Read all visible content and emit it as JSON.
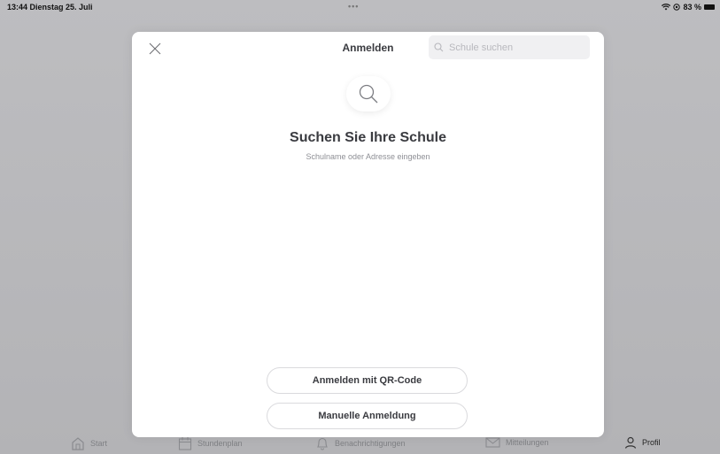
{
  "status_bar": {
    "time_date": "13:44  Dienstag 25. Juli",
    "dots": "•••",
    "battery": "83 %"
  },
  "modal": {
    "title": "Anmelden",
    "search": {
      "placeholder": "Schule suchen",
      "value": ""
    },
    "hero": {
      "title": "Suchen Sie Ihre Schule",
      "subtitle": "Schulname oder Adresse eingeben"
    },
    "buttons": {
      "qr_label": "Anmelden mit QR-Code",
      "manual_label": "Manuelle Anmeldung"
    }
  },
  "tab_bar": {
    "items": [
      {
        "label": "Start",
        "icon": "home-icon"
      },
      {
        "label": "Stundenplan",
        "icon": "calendar-icon"
      },
      {
        "label": "Benachrichtigungen",
        "icon": "bell-icon"
      },
      {
        "label": "Mitteilungen",
        "icon": "mail-icon"
      },
      {
        "label": "Profil",
        "icon": "person-icon"
      }
    ],
    "active": "Profil"
  },
  "colors": {
    "backdrop": "#b9b9bb",
    "modal_bg": "#ffffff",
    "title_text": "#3a3b40",
    "muted_text": "#8e8f95",
    "search_bg": "#f0f0f2"
  }
}
